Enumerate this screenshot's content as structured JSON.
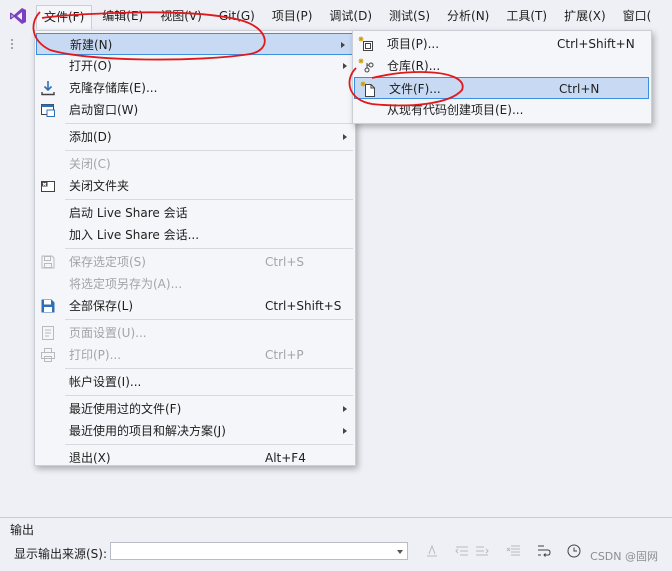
{
  "menubar": {
    "items": [
      "文件(F)",
      "编辑(E)",
      "视图(V)",
      "Git(G)",
      "项目(P)",
      "调试(D)",
      "测试(S)",
      "分析(N)",
      "工具(T)",
      "扩展(X)",
      "窗口("
    ]
  },
  "file_menu": {
    "new": {
      "label": "新建(N)"
    },
    "open": {
      "label": "打开(O)"
    },
    "clone": {
      "label": "克隆存储库(E)..."
    },
    "start_window": {
      "label": "启动窗口(W)"
    },
    "add": {
      "label": "添加(D)"
    },
    "close": {
      "label": "关闭(C)"
    },
    "close_folder": {
      "label": "关闭文件夹"
    },
    "start_live_share": {
      "label": "启动 Live Share 会话"
    },
    "join_live_share": {
      "label": "加入 Live Share 会话..."
    },
    "save_selected": {
      "label": "保存选定项(S)",
      "shortcut": "Ctrl+S"
    },
    "save_selected_as": {
      "label": "将选定项另存为(A)..."
    },
    "save_all": {
      "label": "全部保存(L)",
      "shortcut": "Ctrl+Shift+S"
    },
    "page_setup": {
      "label": "页面设置(U)..."
    },
    "print": {
      "label": "打印(P)...",
      "shortcut": "Ctrl+P"
    },
    "account_settings": {
      "label": "帐户设置(I)..."
    },
    "recent_files": {
      "label": "最近使用过的文件(F)"
    },
    "recent_projects": {
      "label": "最近使用的项目和解决方案(J)"
    },
    "exit": {
      "label": "退出(X)",
      "shortcut": "Alt+F4"
    }
  },
  "new_submenu": {
    "project": {
      "label": "项目(P)...",
      "shortcut": "Ctrl+Shift+N"
    },
    "repository": {
      "label": "仓库(R)..."
    },
    "file": {
      "label": "文件(F)...",
      "shortcut": "Ctrl+N"
    },
    "from_existing": {
      "label": "从现有代码创建项目(E)..."
    }
  },
  "output_panel": {
    "title": "输出",
    "source_label": "显示输出来源(S):",
    "source_value": ""
  },
  "watermark": "CSDN @固网",
  "colors": {
    "menu_bg": "#f5f6f9",
    "highlight_bg": "#c8daf3",
    "highlight_border": "#3e8ee0",
    "annotation_red": "#e0191c",
    "vs_purple": "#7b3fbf"
  },
  "icons": {
    "logo": "visual-studio-logo-icon",
    "clone": "download-icon",
    "start_window": "window-icon",
    "close_folder": "close-folder-icon",
    "save_selected": "save-icon",
    "save_all": "save-all-icon",
    "page_setup": "page-setup-icon",
    "print": "printer-icon",
    "new_project": "new-project-icon",
    "new_repository": "new-repository-icon",
    "new_file": "new-file-icon"
  }
}
